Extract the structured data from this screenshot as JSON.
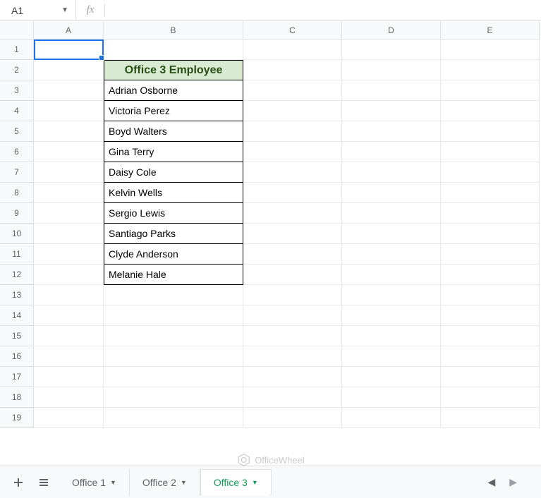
{
  "formula_bar": {
    "cell_ref": "A1",
    "formula": ""
  },
  "columns": [
    "A",
    "B",
    "C",
    "D",
    "E"
  ],
  "rows": [
    1,
    2,
    3,
    4,
    5,
    6,
    7,
    8,
    9,
    10,
    11,
    12,
    13,
    14,
    15,
    16,
    17,
    18,
    19
  ],
  "table": {
    "header": "Office 3 Employee",
    "data": [
      "Adrian Osborne",
      "Victoria Perez",
      "Boyd Walters",
      "Gina Terry",
      "Daisy Cole",
      "Kelvin Wells",
      "Sergio Lewis",
      "Santiago Parks",
      "Clyde Anderson",
      "Melanie Hale"
    ]
  },
  "sheet_tabs": {
    "items": [
      {
        "label": "Office 1",
        "active": false
      },
      {
        "label": "Office 2",
        "active": false
      },
      {
        "label": "Office 3",
        "active": true
      }
    ]
  },
  "watermark": "OfficeWheel"
}
